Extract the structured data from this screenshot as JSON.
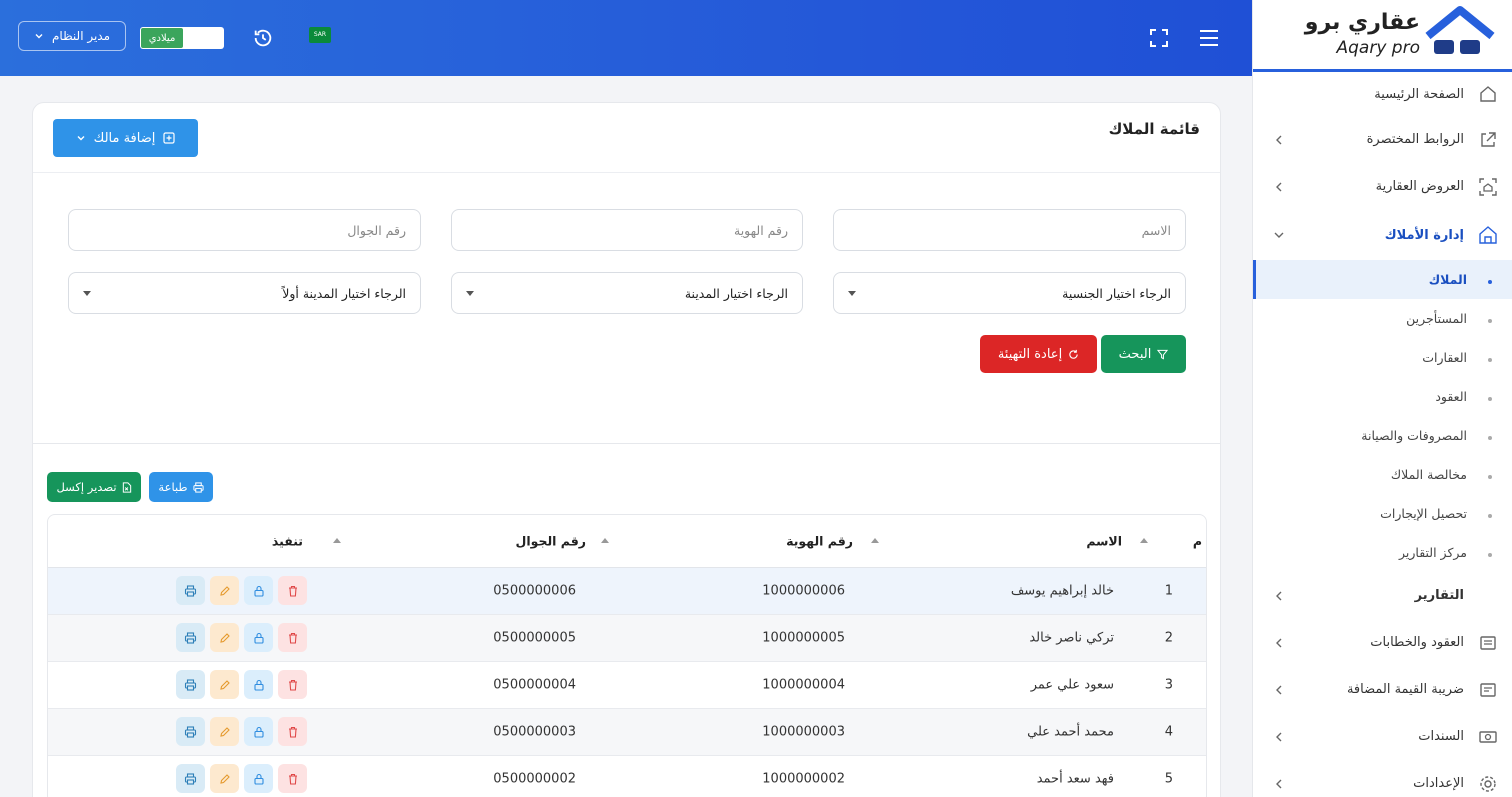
{
  "header": {
    "user_label": "مدير النظام",
    "calendar_label": "ميلادي",
    "flag_label": "SAR"
  },
  "sidebar": {
    "logo_text": "عقاري برو",
    "logo_sub": "Aqary pro",
    "items": [
      {
        "label": "الصفحة الرئيسية"
      },
      {
        "label": "الروابط المختصرة"
      },
      {
        "label": "العروض العقارية"
      },
      {
        "label": "إدارة الأملاك"
      }
    ],
    "sub_items": [
      {
        "label": "الملاك"
      },
      {
        "label": "المستأجرين"
      },
      {
        "label": "العقارات"
      },
      {
        "label": "العقود"
      },
      {
        "label": "المصروفات والصيانة"
      },
      {
        "label": "مخالصة الملاك"
      },
      {
        "label": "تحصيل الإيجارات"
      },
      {
        "label": "مركز التقارير"
      }
    ],
    "bottom_items": [
      {
        "label": "التقارير"
      },
      {
        "label": "العقود والخطابات"
      },
      {
        "label": "ضريبة القيمة المضافة"
      },
      {
        "label": "السندات"
      },
      {
        "label": "الإعدادات"
      }
    ]
  },
  "main": {
    "title": "قائمة الملاك",
    "add_button": "إضافة مالك",
    "filters": {
      "name_placeholder": "الاسم",
      "id_placeholder": "رقم الهوية",
      "phone_placeholder": "رقم الجوال",
      "nationality": "الرجاء اختيار الجنسية",
      "city": "الرجاء اختيار المدينة",
      "district": "الرجاء اختيار المدينة أولاً"
    },
    "search_button": "البحث",
    "reset_button": "إعادة التهيئة",
    "print_button": "طباعة",
    "export_button": "تصدير إكسل"
  },
  "table": {
    "headers": {
      "index": "م",
      "name": "الاسم",
      "id": "رقم الهوية",
      "phone": "رقم الجوال",
      "actions": "تنفيذ"
    },
    "rows": [
      {
        "index": "1",
        "name": "خالد إبراهيم يوسف",
        "id": "1000000006",
        "phone": "0500000006"
      },
      {
        "index": "2",
        "name": "تركي ناصر خالد",
        "id": "1000000005",
        "phone": "0500000005"
      },
      {
        "index": "3",
        "name": "سعود علي عمر",
        "id": "1000000004",
        "phone": "0500000004"
      },
      {
        "index": "4",
        "name": "محمد أحمد علي",
        "id": "1000000003",
        "phone": "0500000003"
      },
      {
        "index": "5",
        "name": "فهد سعد أحمد",
        "id": "1000000002",
        "phone": "0500000002"
      }
    ]
  }
}
